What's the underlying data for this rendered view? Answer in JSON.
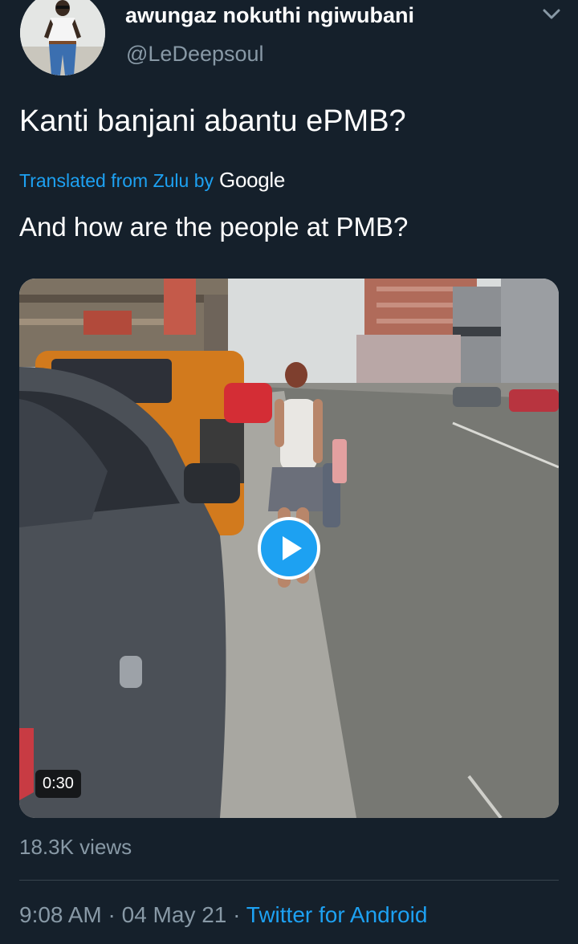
{
  "author": {
    "display_name": "awungaz nokuthi ngiwubani",
    "handle": "@LeDeepsoul",
    "avatar_icon": "profile-photo",
    "menu_icon": "chevron-down-icon"
  },
  "tweet": {
    "text": "Kanti banjani abantu ePMB?",
    "translation_label": "Translated from Zulu by",
    "translation_provider": "Google",
    "translated_text": "And how are the people at PMB?"
  },
  "media": {
    "type": "video",
    "duration": "0:30",
    "play_icon": "play-icon"
  },
  "stats": {
    "views": "18.3K views"
  },
  "meta": {
    "time": "9:08 AM",
    "separator": "·",
    "date": "04 May 21",
    "source": "Twitter for Android"
  },
  "colors": {
    "background": "#15202b",
    "accent": "#1da1f2",
    "secondary_text": "#8899a6",
    "divider": "#38444d"
  }
}
